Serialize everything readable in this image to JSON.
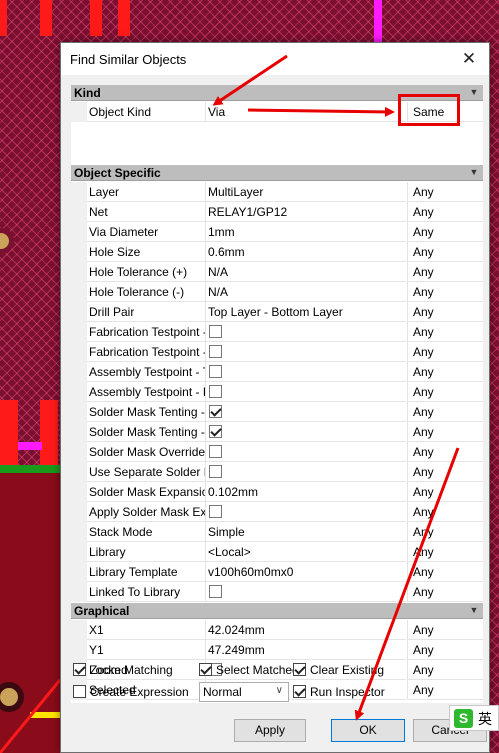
{
  "dialog": {
    "title": "Find Similar Objects",
    "close_glyph": "✕"
  },
  "sections": {
    "kind": "Kind",
    "object_specific": "Object Specific",
    "graphical": "Graphical"
  },
  "kind_rows": [
    {
      "name": "Object Kind",
      "value": "Via",
      "match": "Same"
    }
  ],
  "object_specific_rows": [
    {
      "name": "Layer",
      "value": "MultiLayer",
      "match": "Any"
    },
    {
      "name": "Net",
      "value": "RELAY1/GP12",
      "match": "Any"
    },
    {
      "name": "Via Diameter",
      "value": "1mm",
      "match": "Any"
    },
    {
      "name": "Hole Size",
      "value": "0.6mm",
      "match": "Any"
    },
    {
      "name": "Hole Tolerance (+)",
      "value": "N/A",
      "match": "Any"
    },
    {
      "name": "Hole Tolerance (-)",
      "value": "N/A",
      "match": "Any"
    },
    {
      "name": "Drill Pair",
      "value": "Top Layer - Bottom Layer",
      "match": "Any"
    },
    {
      "name": "Fabrication Testpoint -",
      "checkbox": false,
      "match": "Any"
    },
    {
      "name": "Fabrication Testpoint -",
      "checkbox": false,
      "match": "Any"
    },
    {
      "name": "Assembly Testpoint - T",
      "checkbox": false,
      "match": "Any"
    },
    {
      "name": "Assembly Testpoint - B",
      "checkbox": false,
      "match": "Any"
    },
    {
      "name": "Solder Mask Tenting -",
      "checkbox": true,
      "match": "Any"
    },
    {
      "name": "Solder Mask Tenting -",
      "checkbox": true,
      "match": "Any"
    },
    {
      "name": "Solder Mask Override",
      "checkbox": false,
      "match": "Any"
    },
    {
      "name": "Use Separate Solder M",
      "checkbox": false,
      "match": "Any"
    },
    {
      "name": "Solder Mask Expansior",
      "value": "0.102mm",
      "match": "Any"
    },
    {
      "name": "Apply Solder Mask Exp",
      "checkbox": false,
      "match": "Any"
    },
    {
      "name": "Stack Mode",
      "value": "Simple",
      "match": "Any"
    },
    {
      "name": "Library",
      "value": "<Local>",
      "match": "Any"
    },
    {
      "name": "Library Template",
      "value": "v100h60m0mx0",
      "match": "Any"
    },
    {
      "name": "Linked To Library",
      "checkbox": false,
      "match": "Any"
    }
  ],
  "graphical_rows": [
    {
      "name": "X1",
      "value": "42.024mm",
      "match": "Any"
    },
    {
      "name": "Y1",
      "value": "47.249mm",
      "match": "Any"
    },
    {
      "name": "Locked",
      "checkbox": false,
      "match": "Any"
    },
    {
      "name": "Selected",
      "checkbox": false,
      "match": "Any"
    }
  ],
  "options": {
    "zoom_matching": {
      "label": "Zoom Matching",
      "checked": true
    },
    "select_matched": {
      "label": "Select Matched",
      "checked": true
    },
    "clear_existing": {
      "label": "Clear Existing",
      "checked": true
    },
    "create_expression": {
      "label": "Create Expression",
      "checked": false
    },
    "mask_mode": {
      "value": "Normal"
    },
    "run_inspector": {
      "label": "Run Inspector",
      "checked": true
    }
  },
  "buttons": {
    "apply": "Apply",
    "ok": "OK",
    "cancel": "Cancel"
  },
  "ime": {
    "logo": "S",
    "label": "英"
  },
  "colors": {
    "annotation": "#e60000",
    "section_header": "#bdbdbd",
    "pcb_background": "#7a1030"
  }
}
